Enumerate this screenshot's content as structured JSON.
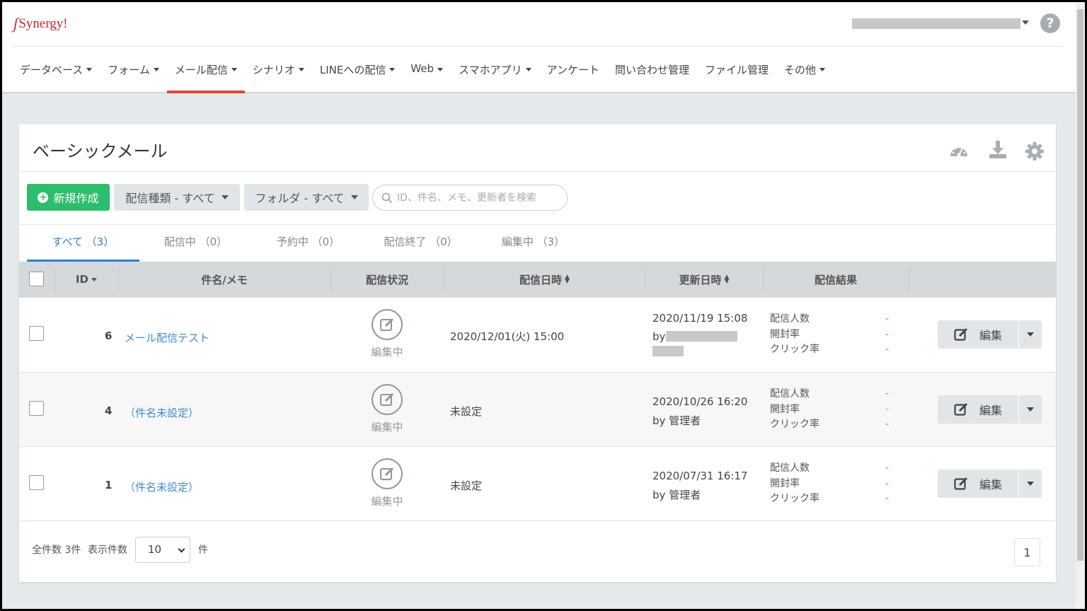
{
  "brand": {
    "logo_text": "Synergy!",
    "accent": "#c9252c"
  },
  "nav": {
    "items": [
      {
        "label": "データベース",
        "caret": true
      },
      {
        "label": "フォーム",
        "caret": true
      },
      {
        "label": "メール配信",
        "caret": true,
        "active": true
      },
      {
        "label": "シナリオ",
        "caret": true
      },
      {
        "label": "LINEへの配信",
        "caret": true
      },
      {
        "label": "Web",
        "caret": true
      },
      {
        "label": "スマホアプリ",
        "caret": true
      },
      {
        "label": "アンケート",
        "caret": false
      },
      {
        "label": "問い合わせ管理",
        "caret": false
      },
      {
        "label": "ファイル管理",
        "caret": false
      },
      {
        "label": "その他",
        "caret": true
      }
    ]
  },
  "help": {
    "label": "?"
  },
  "page": {
    "title": "ベーシックメール",
    "new_button": "新規作成",
    "filter_type": "配信種類 - すべて",
    "filter_folder": "フォルダ - すべて",
    "search_placeholder": "ID、件名、メモ、更新者を検索"
  },
  "tabs": [
    "すべて （3）",
    "配信中 （0）",
    "予約中 （0）",
    "配信終了 （0）",
    "編集中 （3）"
  ],
  "table": {
    "headers": {
      "id": "ID",
      "subject": "件名/メモ",
      "status": "配信状況",
      "send_date": "配信日時",
      "updated": "更新日時",
      "result": "配信結果"
    },
    "result_labels": [
      "配信人数",
      "開封率",
      "クリック率"
    ],
    "rows": [
      {
        "id": "6",
        "subject": "メール配信テスト",
        "status": "編集中",
        "send_date": "2020/12/01(火) 15:00",
        "updated": "2020/11/19 15:08",
        "by": "by",
        "results": [
          "-",
          "-",
          "-"
        ],
        "edit": "編集"
      },
      {
        "id": "4",
        "subject": "（件名未設定）",
        "status": "編集中",
        "send_date": "未設定",
        "updated": "2020/10/26 16:20",
        "by": "by 管理者",
        "results": [
          "-",
          "-",
          "-"
        ],
        "edit": "編集"
      },
      {
        "id": "1",
        "subject": "（件名未設定）",
        "status": "編集中",
        "send_date": "未設定",
        "updated": "2020/07/31 16:17",
        "by": "by 管理者",
        "results": [
          "-",
          "-",
          "-"
        ],
        "edit": "編集"
      }
    ]
  },
  "footer": {
    "total": "全件数 3件",
    "per_page_label": "表示件数",
    "per_page_value": "10",
    "unit": "件",
    "page": "1"
  }
}
